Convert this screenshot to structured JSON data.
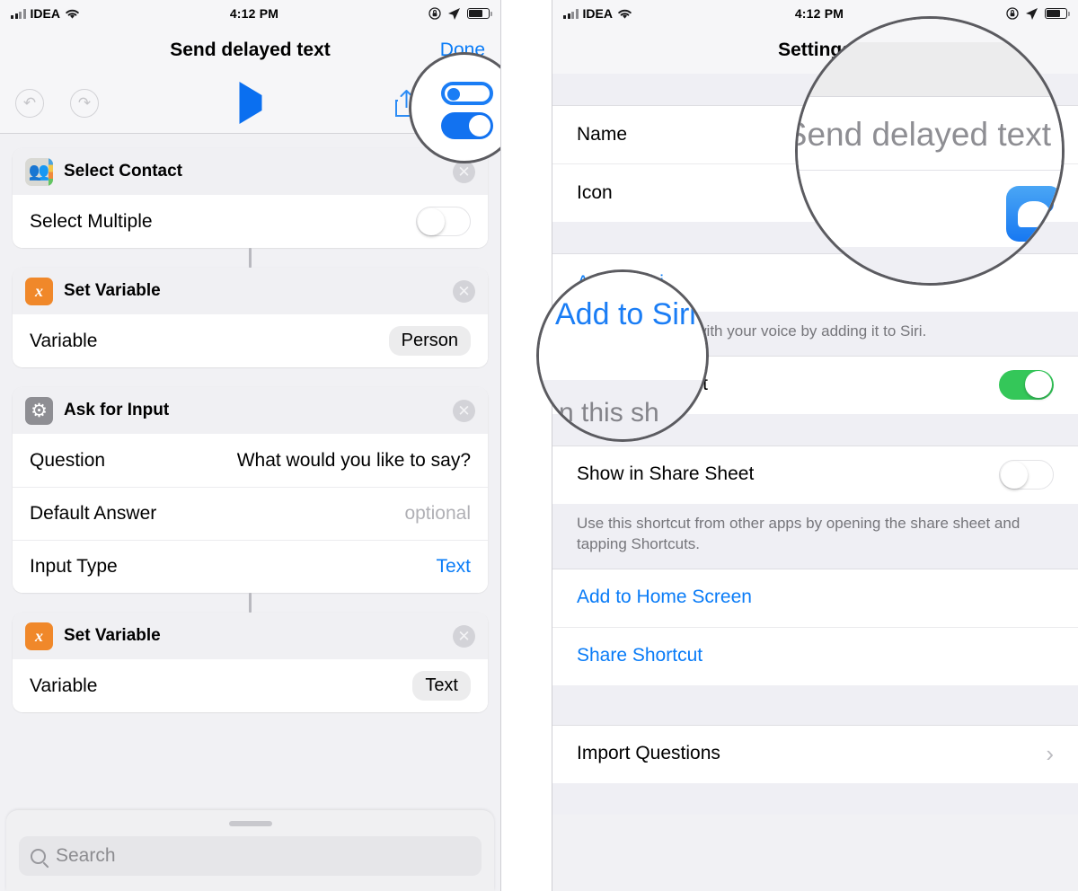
{
  "status_bar": {
    "carrier": "IDEA",
    "time": "4:12 PM",
    "wifi_icon": "wifi-icon",
    "signal_icon": "cellular-signal-icon",
    "rotation_lock_icon": "rotation-lock-icon",
    "location_icon": "location-arrow-icon",
    "battery_icon": "battery-icon"
  },
  "left_screen": {
    "nav": {
      "title": "Send delayed text",
      "done_label": "Done"
    },
    "toolbar": {
      "undo_icon": "undo-icon",
      "redo_icon": "redo-icon",
      "play_icon": "play-icon",
      "share_icon": "share-icon",
      "settings_toggles_icon": "settings-toggles-icon"
    },
    "actions": [
      {
        "icon": "contacts-icon",
        "title": "Select Contact",
        "close_icon": "close-circle-icon",
        "rows": [
          {
            "label": "Select Multiple",
            "control": "switch",
            "value": "off"
          }
        ]
      },
      {
        "icon": "variable-x-icon",
        "title": "Set Variable",
        "close_icon": "close-circle-icon",
        "rows": [
          {
            "label": "Variable",
            "control": "pill",
            "value": "Person"
          }
        ]
      },
      {
        "icon": "gear-icon",
        "title": "Ask for Input",
        "close_icon": "close-circle-icon",
        "rows": [
          {
            "label": "Question",
            "control": "text",
            "value": "What would you like to say?"
          },
          {
            "label": "Default Answer",
            "control": "placeholder",
            "value": "optional"
          },
          {
            "label": "Input Type",
            "control": "link",
            "value": "Text"
          }
        ]
      },
      {
        "icon": "variable-x-icon",
        "title": "Set Variable",
        "close_icon": "close-circle-icon",
        "rows": [
          {
            "label": "Variable",
            "control": "pill",
            "value": "Text"
          }
        ]
      }
    ],
    "search": {
      "placeholder": "Search",
      "icon": "search-icon",
      "grabber": "drag-handle"
    }
  },
  "right_screen": {
    "nav": {
      "title": "Settings"
    },
    "rows": {
      "name_label": "Name",
      "name_value": "Send delayed text",
      "icon_label": "Icon",
      "icon_value": "messages-app-icon",
      "add_to_siri": "Add to Siri",
      "siri_footer": "Run this shortcut with your voice by adding it to Siri.",
      "show_in_widget": "Show in Widget",
      "show_in_widget_value": "on",
      "show_in_share_sheet": "Show in Share Sheet",
      "show_in_share_sheet_value": "off",
      "share_sheet_footer": "Use this shortcut from other apps by opening the share sheet and tapping Shortcuts.",
      "add_to_home_screen": "Add to Home Screen",
      "share_shortcut": "Share Shortcut",
      "import_questions": "Import Questions",
      "chevron_icon": "chevron-right-icon"
    }
  },
  "magnifiers": {
    "toggles": {
      "name": "settings-toggles-callout"
    },
    "name_field": {
      "name": "name-field-callout",
      "text": "Send delayed text"
    },
    "siri": {
      "name": "add-to-siri-callout",
      "text": "Add to Siri",
      "partial_text": "n this sh"
    }
  },
  "colors": {
    "accent_blue": "#0a7cf7",
    "switch_green": "#34c759",
    "variable_orange": "#f0882a",
    "gear_gray": "#8e8e93",
    "messages_blue": "#1778f2"
  }
}
